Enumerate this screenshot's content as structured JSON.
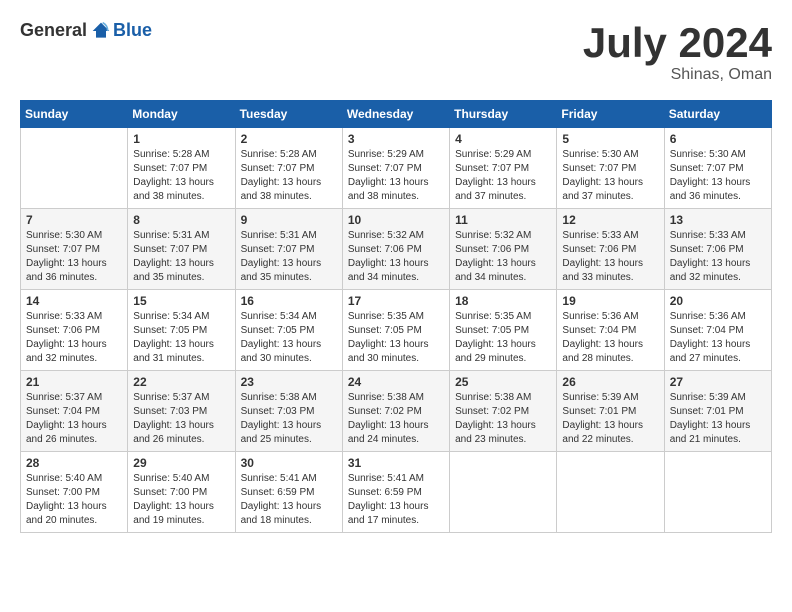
{
  "header": {
    "logo_general": "General",
    "logo_blue": "Blue",
    "month_title": "July 2024",
    "location": "Shinas, Oman"
  },
  "days_of_week": [
    "Sunday",
    "Monday",
    "Tuesday",
    "Wednesday",
    "Thursday",
    "Friday",
    "Saturday"
  ],
  "weeks": [
    [
      {
        "day": "",
        "sunrise": "",
        "sunset": "",
        "daylight": ""
      },
      {
        "day": "1",
        "sunrise": "5:28 AM",
        "sunset": "7:07 PM",
        "daylight": "13 hours and 38 minutes."
      },
      {
        "day": "2",
        "sunrise": "5:28 AM",
        "sunset": "7:07 PM",
        "daylight": "13 hours and 38 minutes."
      },
      {
        "day": "3",
        "sunrise": "5:29 AM",
        "sunset": "7:07 PM",
        "daylight": "13 hours and 38 minutes."
      },
      {
        "day": "4",
        "sunrise": "5:29 AM",
        "sunset": "7:07 PM",
        "daylight": "13 hours and 37 minutes."
      },
      {
        "day": "5",
        "sunrise": "5:30 AM",
        "sunset": "7:07 PM",
        "daylight": "13 hours and 37 minutes."
      },
      {
        "day": "6",
        "sunrise": "5:30 AM",
        "sunset": "7:07 PM",
        "daylight": "13 hours and 36 minutes."
      }
    ],
    [
      {
        "day": "7",
        "sunrise": "5:30 AM",
        "sunset": "7:07 PM",
        "daylight": "13 hours and 36 minutes."
      },
      {
        "day": "8",
        "sunrise": "5:31 AM",
        "sunset": "7:07 PM",
        "daylight": "13 hours and 35 minutes."
      },
      {
        "day": "9",
        "sunrise": "5:31 AM",
        "sunset": "7:07 PM",
        "daylight": "13 hours and 35 minutes."
      },
      {
        "day": "10",
        "sunrise": "5:32 AM",
        "sunset": "7:06 PM",
        "daylight": "13 hours and 34 minutes."
      },
      {
        "day": "11",
        "sunrise": "5:32 AM",
        "sunset": "7:06 PM",
        "daylight": "13 hours and 34 minutes."
      },
      {
        "day": "12",
        "sunrise": "5:33 AM",
        "sunset": "7:06 PM",
        "daylight": "13 hours and 33 minutes."
      },
      {
        "day": "13",
        "sunrise": "5:33 AM",
        "sunset": "7:06 PM",
        "daylight": "13 hours and 32 minutes."
      }
    ],
    [
      {
        "day": "14",
        "sunrise": "5:33 AM",
        "sunset": "7:06 PM",
        "daylight": "13 hours and 32 minutes."
      },
      {
        "day": "15",
        "sunrise": "5:34 AM",
        "sunset": "7:05 PM",
        "daylight": "13 hours and 31 minutes."
      },
      {
        "day": "16",
        "sunrise": "5:34 AM",
        "sunset": "7:05 PM",
        "daylight": "13 hours and 30 minutes."
      },
      {
        "day": "17",
        "sunrise": "5:35 AM",
        "sunset": "7:05 PM",
        "daylight": "13 hours and 30 minutes."
      },
      {
        "day": "18",
        "sunrise": "5:35 AM",
        "sunset": "7:05 PM",
        "daylight": "13 hours and 29 minutes."
      },
      {
        "day": "19",
        "sunrise": "5:36 AM",
        "sunset": "7:04 PM",
        "daylight": "13 hours and 28 minutes."
      },
      {
        "day": "20",
        "sunrise": "5:36 AM",
        "sunset": "7:04 PM",
        "daylight": "13 hours and 27 minutes."
      }
    ],
    [
      {
        "day": "21",
        "sunrise": "5:37 AM",
        "sunset": "7:04 PM",
        "daylight": "13 hours and 26 minutes."
      },
      {
        "day": "22",
        "sunrise": "5:37 AM",
        "sunset": "7:03 PM",
        "daylight": "13 hours and 26 minutes."
      },
      {
        "day": "23",
        "sunrise": "5:38 AM",
        "sunset": "7:03 PM",
        "daylight": "13 hours and 25 minutes."
      },
      {
        "day": "24",
        "sunrise": "5:38 AM",
        "sunset": "7:02 PM",
        "daylight": "13 hours and 24 minutes."
      },
      {
        "day": "25",
        "sunrise": "5:38 AM",
        "sunset": "7:02 PM",
        "daylight": "13 hours and 23 minutes."
      },
      {
        "day": "26",
        "sunrise": "5:39 AM",
        "sunset": "7:01 PM",
        "daylight": "13 hours and 22 minutes."
      },
      {
        "day": "27",
        "sunrise": "5:39 AM",
        "sunset": "7:01 PM",
        "daylight": "13 hours and 21 minutes."
      }
    ],
    [
      {
        "day": "28",
        "sunrise": "5:40 AM",
        "sunset": "7:00 PM",
        "daylight": "13 hours and 20 minutes."
      },
      {
        "day": "29",
        "sunrise": "5:40 AM",
        "sunset": "7:00 PM",
        "daylight": "13 hours and 19 minutes."
      },
      {
        "day": "30",
        "sunrise": "5:41 AM",
        "sunset": "6:59 PM",
        "daylight": "13 hours and 18 minutes."
      },
      {
        "day": "31",
        "sunrise": "5:41 AM",
        "sunset": "6:59 PM",
        "daylight": "13 hours and 17 minutes."
      },
      {
        "day": "",
        "sunrise": "",
        "sunset": "",
        "daylight": ""
      },
      {
        "day": "",
        "sunrise": "",
        "sunset": "",
        "daylight": ""
      },
      {
        "day": "",
        "sunrise": "",
        "sunset": "",
        "daylight": ""
      }
    ]
  ],
  "labels": {
    "sunrise_prefix": "Sunrise: ",
    "sunset_prefix": "Sunset: ",
    "daylight_prefix": "Daylight: "
  }
}
